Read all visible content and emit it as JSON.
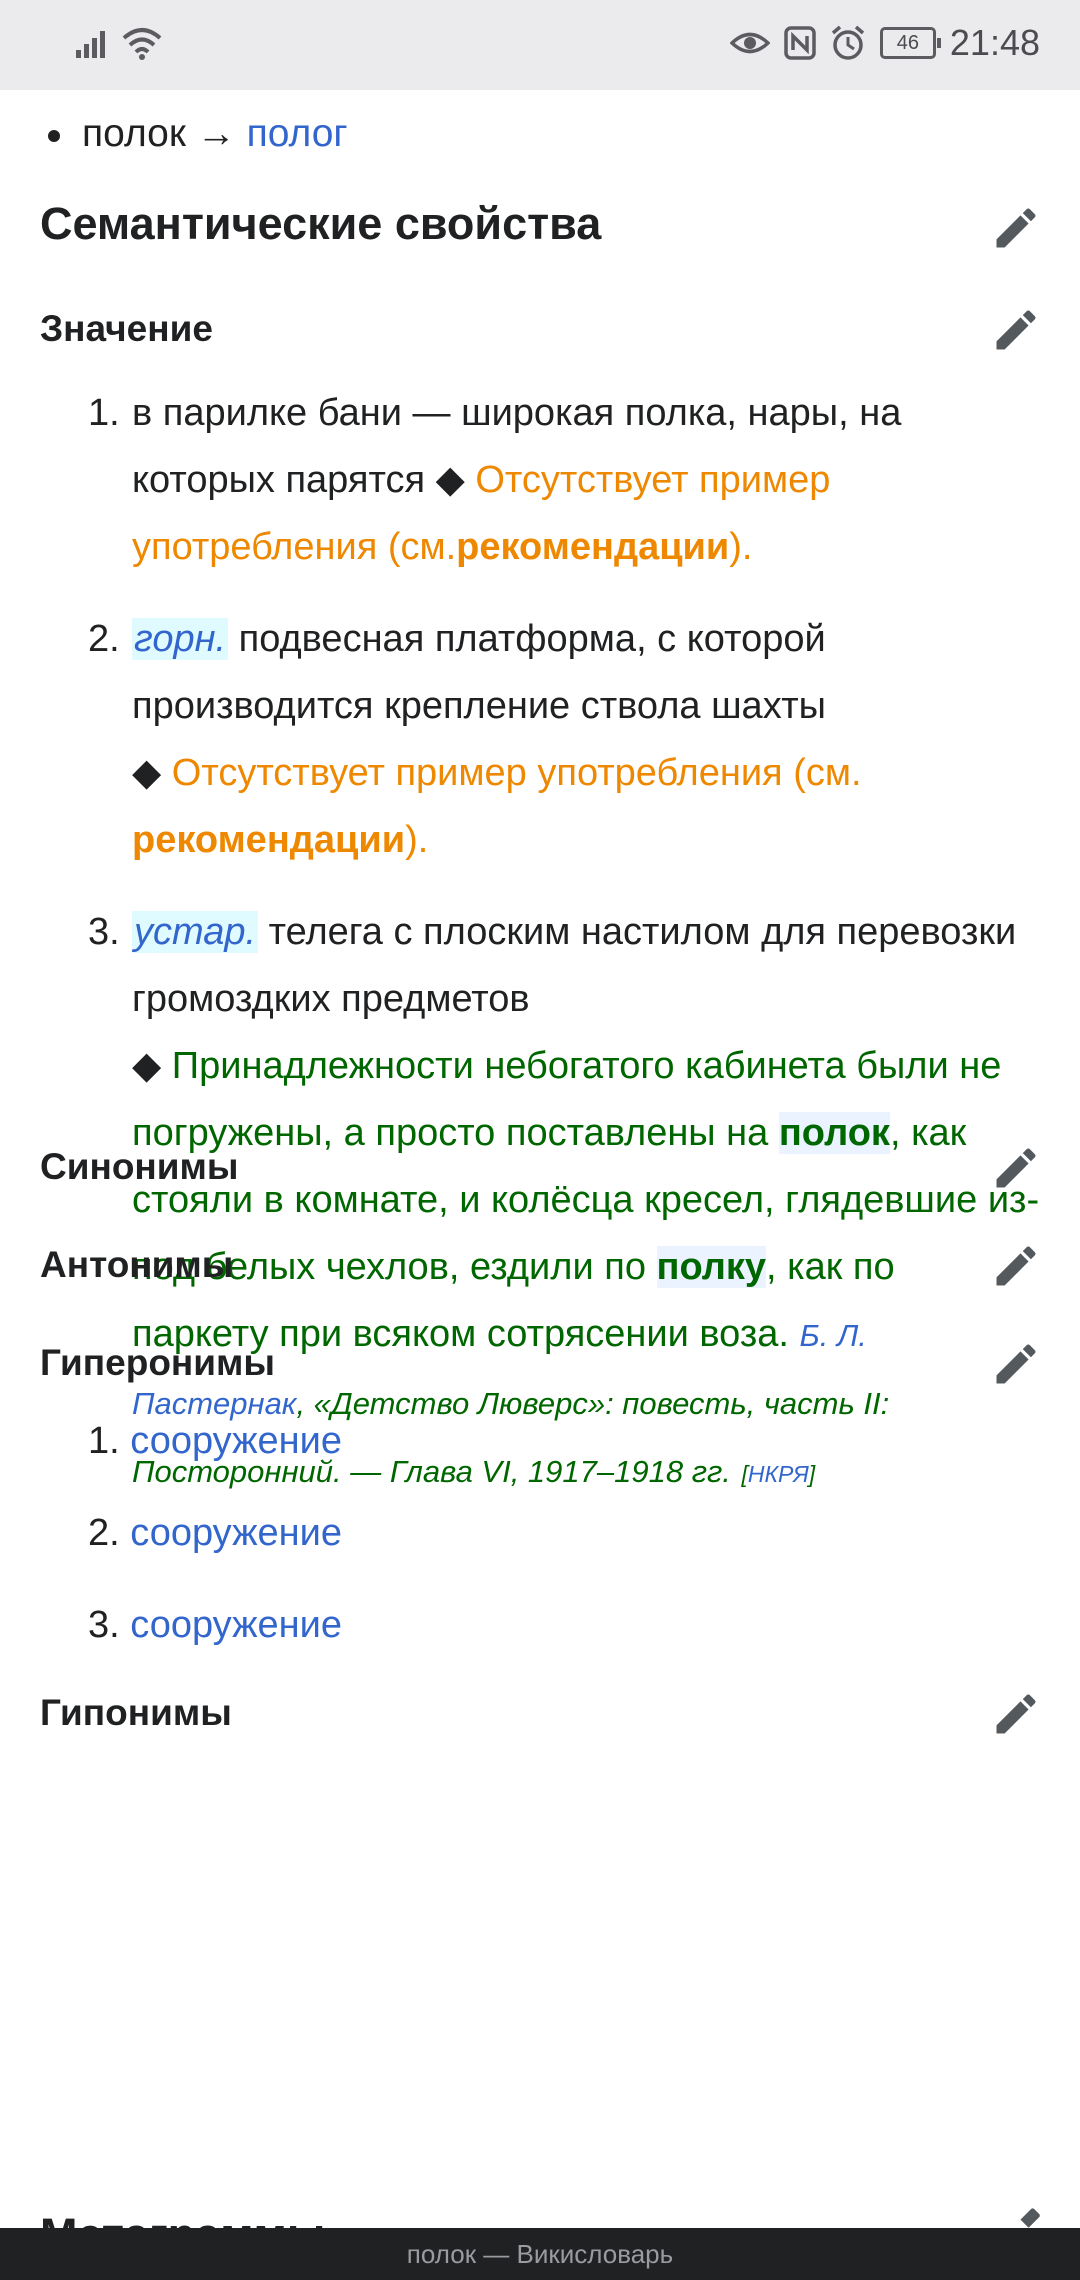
{
  "status_bar": {
    "time": "21:48",
    "battery": "46",
    "left_icons": [
      "signal-icon",
      "wifi-icon"
    ],
    "right_icons": [
      "eye-icon",
      "nfc-icon",
      "alarm-icon",
      "battery-icon"
    ]
  },
  "top_line": {
    "word": "полок",
    "arrow": "→",
    "link": "полог"
  },
  "semantic": {
    "title": "Семантические свойства"
  },
  "meaning": {
    "title": "Значение"
  },
  "definitions": [
    {
      "num": "1.",
      "text": "в парилке бани — широкая полка, нары, на которых парятся",
      "diamond": "◆",
      "missing_pre": "Отсутствует пример употребления (см.",
      "missing_link": "рекомендации",
      "missing_post": ")."
    },
    {
      "num": "2.",
      "label": "горн.",
      "text": "подвесная платформа, с которой производится крепление ствола шахты",
      "diamond": "◆",
      "missing_pre": "Отсутствует пример употребления (см.",
      "missing_link": "рекомендации",
      "missing_post": ")."
    },
    {
      "num": "3.",
      "label": "устар.",
      "text": "телега с плоским настилом для перевозки громоздких предметов",
      "diamond": "◆",
      "example_pre": "Принадлежности небогатого кабинета были не погружены, а просто поставлены на",
      "example_hl1": "полок",
      "example_mid": ", как стояли в комнате, и колёсца кресел, глядевшие из-под белых чехлов, ездили по",
      "example_hl2": "полку",
      "example_post": ", как по паркету при всяком сотрясении воза.",
      "src_author": "Б. Л. Пастернак",
      "src_rest": ", «Детство Люверс»: повесть, часть II: Посторонний. — Глава VI, 1917–1918 гг.",
      "nkrya_open": "[",
      "nkrya": "НКРЯ",
      "nkrya_close": "]"
    }
  ],
  "sections": {
    "synonyms": "Синонимы",
    "antonyms": "Антонимы",
    "hyperonyms": "Гиперонимы",
    "hyponyms": "Гипонимы",
    "metagrams": "Метаграммы"
  },
  "hyperonyms_list": [
    {
      "num": "1.",
      "link": "сооружение"
    },
    {
      "num": "2.",
      "link": "сооружение"
    },
    {
      "num": "3.",
      "link": "сооружение"
    }
  ],
  "footer": {
    "title": "полок — Викисловарь"
  },
  "colors": {
    "link": "#3366cc",
    "missing_example": "#ee8800",
    "example": "#006600",
    "label_bg": "#e0fbff",
    "statusbar_bg": "#ebebee",
    "footer_bg": "#202122"
  }
}
